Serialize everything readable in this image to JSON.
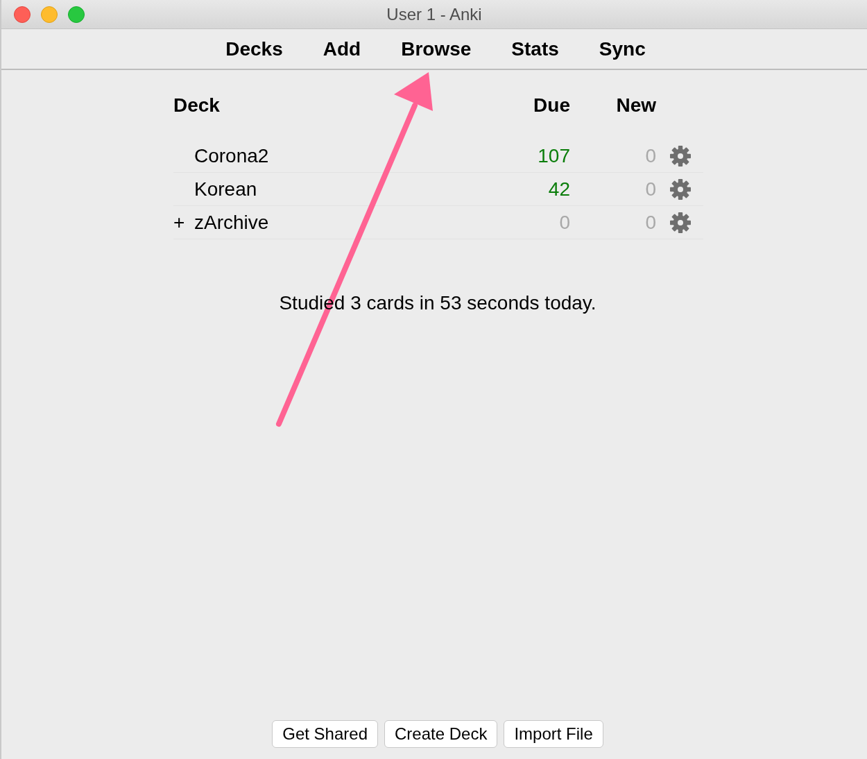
{
  "window": {
    "title": "User 1 - Anki"
  },
  "toolbar": [
    {
      "label": "Decks"
    },
    {
      "label": "Add"
    },
    {
      "label": "Browse"
    },
    {
      "label": "Stats"
    },
    {
      "label": "Sync"
    }
  ],
  "deck_table": {
    "columns": [
      "Deck",
      "Due",
      "New"
    ],
    "rows": [
      {
        "name": "Corona2",
        "due": {
          "text": "107",
          "dimmed": false
        },
        "new": {
          "text": "0",
          "dimmed": true
        }
      },
      {
        "name": "Korean",
        "due": {
          "text": "42",
          "dimmed": false
        },
        "new": {
          "text": "0",
          "dimmed": true
        }
      },
      {
        "expander": "+",
        "name": "zArchive",
        "due": {
          "text": "0",
          "dimmed": true
        },
        "new": {
          "text": "0",
          "dimmed": true
        }
      }
    ]
  },
  "summary": "Studied 3 cards in 53 seconds today.",
  "buttons": [
    "Get Shared",
    "Create Deck",
    "Import File"
  ],
  "annotation": {
    "kind": "arrow",
    "color": "#ff6393"
  }
}
